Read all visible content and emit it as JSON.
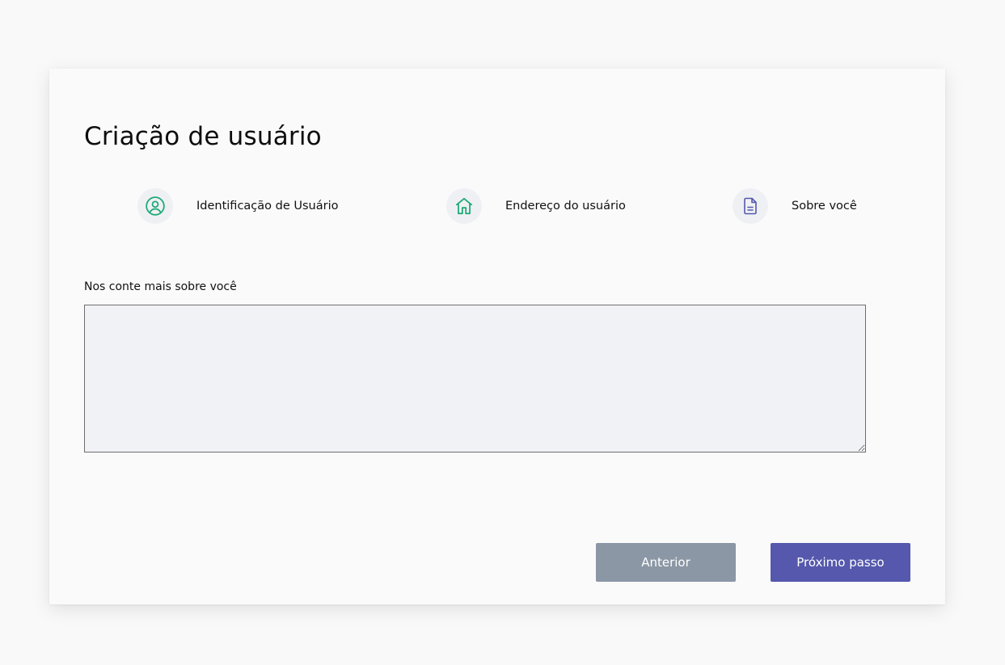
{
  "page": {
    "title": "Criação de usuário"
  },
  "steps": [
    {
      "label": "Identificação de Usuário",
      "icon": "user-circle-icon",
      "color": "#1aa874"
    },
    {
      "label": "Endereço do usuário",
      "icon": "home-icon",
      "color": "#1aa874"
    },
    {
      "label": "Sobre você",
      "icon": "document-icon",
      "color": "#5558ac"
    }
  ],
  "about": {
    "label": "Nos conte mais sobre você",
    "value": "",
    "placeholder": ""
  },
  "buttons": {
    "previous_label": "Anterior",
    "next_label": "Próximo passo"
  },
  "colors": {
    "completed_step": "#1aa874",
    "current_step": "#5558ac",
    "primary_button": "#5558ac",
    "secondary_button": "#8b97a5",
    "textarea_background": "#f1f2f6"
  }
}
